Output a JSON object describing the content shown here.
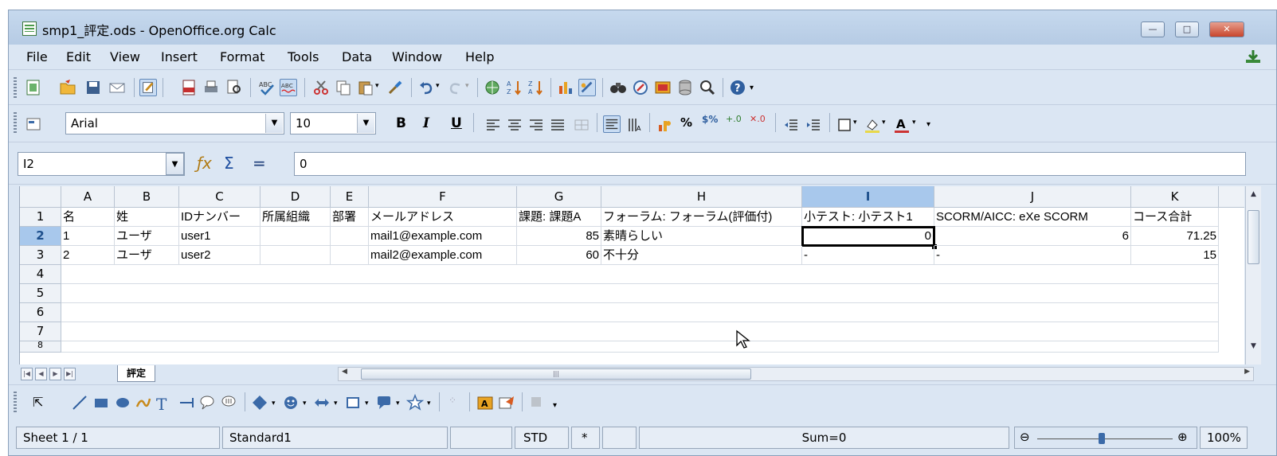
{
  "window": {
    "title": "smp1_評定.ods - OpenOffice.org Calc",
    "controls": {
      "minimize": "—",
      "maximize": "□",
      "close": "✕"
    }
  },
  "menu": [
    "File",
    "Edit",
    "View",
    "Insert",
    "Format",
    "Tools",
    "Data",
    "Window",
    "Help"
  ],
  "format_toolbar": {
    "font_name": "Arial",
    "font_size": "10",
    "bold": "B",
    "italic": "I",
    "underline": "U"
  },
  "formula_bar": {
    "cell_ref": "I2",
    "content": "0",
    "fx_symbol": "ƒx",
    "sum_symbol": "Σ",
    "equals_symbol": "="
  },
  "sheet": {
    "columns": [
      "A",
      "B",
      "C",
      "D",
      "E",
      "F",
      "G",
      "H",
      "I",
      "J",
      "K"
    ],
    "rows": [
      "1",
      "2",
      "3",
      "4",
      "5",
      "6",
      "7",
      "8"
    ],
    "selected_column": "I",
    "selected_row": "2",
    "data": [
      [
        "名",
        "姓",
        "IDナンバー",
        "所属組織",
        "部署",
        "メールアドレス",
        "課題: 課題A",
        "フォーラム: フォーラム(評価付)",
        "小テスト: 小テスト1",
        "SCORM/AICC: eXe SCORM",
        "コース合計"
      ],
      [
        "1",
        "ユーザ",
        "user1",
        "",
        "",
        "mail1@example.com",
        "85",
        "素晴らしい",
        "0",
        "6",
        "71.25"
      ],
      [
        "2",
        "ユーザ",
        "user2",
        "",
        "",
        "mail2@example.com",
        "60",
        "不十分",
        "-",
        "-",
        "15"
      ]
    ]
  },
  "tabs": {
    "sheet_name": "評定"
  },
  "status_bar": {
    "sheet": "Sheet 1 / 1",
    "page_style": "Standard1",
    "selection_mode": "STD",
    "modified": "*",
    "sum": "Sum=0",
    "zoom": "100%",
    "zoom_minus": "⊖",
    "zoom_plus": "⊕"
  }
}
